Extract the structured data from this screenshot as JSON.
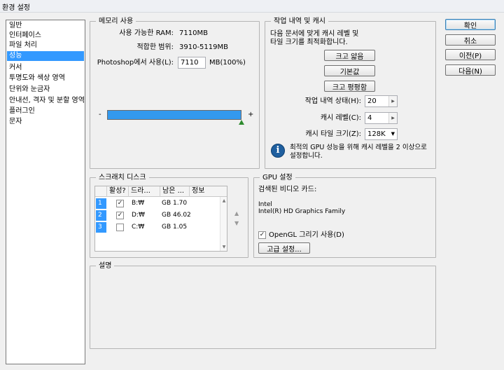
{
  "window": {
    "title": "환경 설정"
  },
  "sidebar": {
    "items": [
      {
        "label": "일반"
      },
      {
        "label": "인터페이스"
      },
      {
        "label": "파일 처리"
      },
      {
        "label": "성능"
      },
      {
        "label": "커서"
      },
      {
        "label": "투명도와 색상 영역"
      },
      {
        "label": "단위와 눈금자"
      },
      {
        "label": "안내선, 격자 및 분할 영역"
      },
      {
        "label": "플러그인"
      },
      {
        "label": "문자"
      }
    ],
    "selected": "성능"
  },
  "memory": {
    "legend": "메모리 사용",
    "available_label": "사용 가능한 RAM:",
    "available_value": "7110MB",
    "range_label": "적합한 범위:",
    "range_value": "3910-5119MB",
    "use_label": "Photoshop에서 사용(L):",
    "use_value": "7110",
    "use_unit": "MB(100%)",
    "slider_minus": "-",
    "slider_plus": "+",
    "slider_fraction": 1.0
  },
  "history": {
    "legend": "작업 내역 및 캐시",
    "desc_line1": "다음 문서에 맞게 캐시 레벨 및",
    "desc_line2": "타일 크기를 최적화합니다.",
    "btn_big_thin": "크고 얇음",
    "btn_default": "기본값",
    "btn_big_flat": "크고 평평함",
    "states_label": "작업 내역 상태(H):",
    "states_value": "20",
    "levels_label": "캐시 레벨(C):",
    "levels_value": "4",
    "tile_label": "캐시 타일 크기(Z):",
    "tile_value": "128K",
    "info_line1": "최적의 GPU 성능을 위해 캐시 레벨을 2 이상으로",
    "info_line2": "설정합니다."
  },
  "scratch": {
    "legend": "스크래치 디스크",
    "columns": [
      "활성?",
      "드라...",
      "남은 ...",
      "정보"
    ],
    "rows": [
      {
        "num": "1",
        "checked": "✓",
        "drive": "B:₩",
        "free": "GB 1.70"
      },
      {
        "num": "2",
        "checked": "✓",
        "drive": "D:₩",
        "free": "GB 46.02"
      },
      {
        "num": "3",
        "checked": "",
        "drive": "C:₩",
        "free": "GB 1.05"
      }
    ]
  },
  "gpu": {
    "legend": "GPU 설정",
    "detected_label": "검색된 비디오 카드:",
    "vendor": "Intel",
    "model": "Intel(R) HD Graphics Family",
    "opengl_label": "OpenGL 그리기 사용(D)",
    "opengl_checked": "✓",
    "advanced_button": "고급 설정..."
  },
  "description": {
    "legend": "설명"
  },
  "actions": {
    "ok": "확인",
    "cancel": "취소",
    "prev": "이전(P)",
    "next": "다음(N)"
  },
  "colors": {
    "accent": "#3399ff",
    "slider_fill": "#3399ee"
  }
}
